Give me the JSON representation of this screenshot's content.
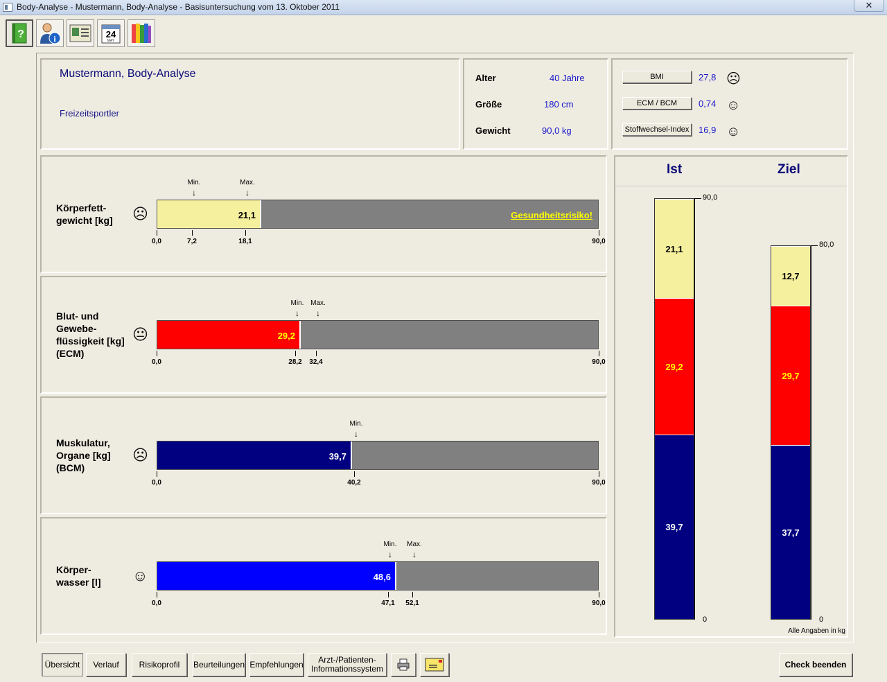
{
  "window": {
    "title": "Body-Analyse - Mustermann, Body-Analyse - Basisuntersuchung vom 13. Oktober 2011",
    "close": "✕"
  },
  "toolbar": {
    "items": [
      {
        "icon": "help-book-icon"
      },
      {
        "icon": "patient-info-icon"
      },
      {
        "icon": "patient-card-icon"
      },
      {
        "icon": "calendar-icon",
        "day": "24",
        "month": "MAY"
      },
      {
        "icon": "books-icon"
      }
    ]
  },
  "patient": {
    "name": "Mustermann, Body-Analyse",
    "category": "Freizeitsportler"
  },
  "stats": {
    "age_label": "Alter",
    "age_value": "40 Jahre",
    "height_label": "Größe",
    "height_value": "180 cm",
    "weight_label": "Gewicht",
    "weight_value": "90,0 kg"
  },
  "indices": [
    {
      "button": "BMI",
      "value": "27,8",
      "mood": "☹"
    },
    {
      "button": "ECM / BCM",
      "value": "0,74",
      "mood": "☺"
    },
    {
      "button": "Stoffwechsel-Index",
      "value": "16,9",
      "mood": "☺"
    }
  ],
  "bars": [
    {
      "label": "Körperfett-\ngewicht [kg]",
      "mood": "☹",
      "value": 21.1,
      "value_text": "21,1",
      "max": 90,
      "fill": "#f5f09e",
      "text_color": "#000",
      "min_mark": 7.2,
      "max_mark": 18.1,
      "ticks": [
        "0,0",
        "7,2",
        "18,1",
        "90,0"
      ],
      "min_label": "Min.",
      "max_label": "Max.",
      "risk": "Gesundheitsrisiko!"
    },
    {
      "label": "Blut- und\nGewebe-\nflüssigkeit [kg]\n(ECM)",
      "mood": "😐",
      "value": 29.2,
      "value_text": "29,2",
      "max": 90,
      "fill": "#ff0000",
      "text_color": "#ffff00",
      "min_mark": 28.2,
      "max_mark": 32.4,
      "ticks": [
        "0,0",
        "28,2",
        "32,4",
        "90,0"
      ],
      "min_label": "Min.",
      "max_label": "Max.",
      "risk": ""
    },
    {
      "label": "Muskulatur,\nOrgane [kg]\n(BCM)",
      "mood": "☹",
      "value": 39.7,
      "value_text": "39,7",
      "max": 90,
      "fill": "#000080",
      "text_color": "#ffffff",
      "min_mark": 40.2,
      "max_mark": null,
      "ticks": [
        "0,0",
        "40,2",
        "",
        "90,0"
      ],
      "min_label": "Min.",
      "max_label": "",
      "risk": ""
    },
    {
      "label": "Körper-\nwasser [l]",
      "mood": "☺",
      "value": 48.6,
      "value_text": "48,6",
      "max": 90,
      "fill": "#0000ff",
      "text_color": "#ffffff",
      "min_mark": 47.1,
      "max_mark": 52.1,
      "ticks": [
        "0,0",
        "47,1",
        "52,1",
        "90,0"
      ],
      "min_label": "Min.",
      "max_label": "Max.",
      "risk": ""
    }
  ],
  "comparison": {
    "ist_label": "Ist",
    "ziel_label": "Ziel",
    "note": "Alle Angaben in kg",
    "ist": {
      "total": 90,
      "top_label": "90,0",
      "bottom_label": "0",
      "segments": [
        {
          "value": 21.1,
          "text": "21,1",
          "color": "#f5f09e",
          "text_color": "#000"
        },
        {
          "value": 29.2,
          "text": "29,2",
          "color": "#ff0000",
          "text_color": "#ffff00"
        },
        {
          "value": 39.7,
          "text": "39,7",
          "color": "#000080",
          "text_color": "#ffffff"
        }
      ]
    },
    "ziel": {
      "total": 80,
      "top_label": "80,0",
      "bottom_label": "0",
      "segments": [
        {
          "value": 12.7,
          "text": "12,7",
          "color": "#f5f09e",
          "text_color": "#000"
        },
        {
          "value": 29.7,
          "text": "29,7",
          "color": "#ff0000",
          "text_color": "#ffff00"
        },
        {
          "value": 37.7,
          "text": "37,7",
          "color": "#000080",
          "text_color": "#ffffff"
        }
      ]
    }
  },
  "bottom_bar": {
    "overview": "Übersicht",
    "history": "Verlauf",
    "risk": "Risikoprofil",
    "assessments": "Beurteilungen",
    "recommendations": "Empfehlungen",
    "info_system": "Arzt-/Patienten-\nInformationssystem",
    "print_icon": "printer-icon",
    "mail_icon": "envelope-icon",
    "finish": "Check beenden"
  }
}
